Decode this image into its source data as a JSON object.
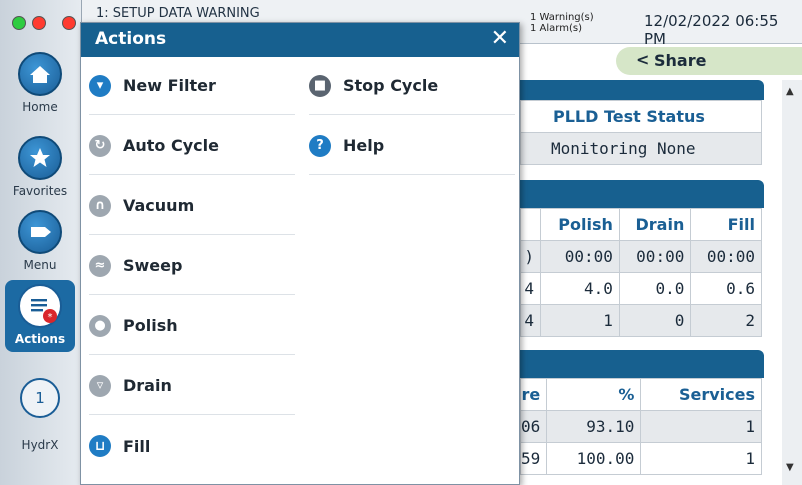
{
  "sidebar": {
    "home_label": "Home",
    "favorites_label": "Favorites",
    "menu_label": "Menu",
    "actions_label": "Actions",
    "hydrx_badge": "1",
    "hydrx_label": "HydrX"
  },
  "header": {
    "title_partial": "1: SETUP DATA WARNING",
    "warnings_line1": "1 Warning(s)",
    "warnings_line2": "1 Alarm(s)",
    "datetime": "12/02/2022 06:55 PM",
    "share_label": "Share"
  },
  "plld_table": {
    "header": "PLLD Test Status",
    "value": "Monitoring None"
  },
  "cycle_table": {
    "headers": [
      "Polish",
      "Drain",
      "Fill"
    ],
    "rows": [
      {
        "clip": ")",
        "polish": "00:00",
        "drain": "00:00",
        "fill": "00:00"
      },
      {
        "clip": "4",
        "polish": "4.0",
        "drain": "0.0",
        "fill": "0.6"
      },
      {
        "clip": "4",
        "polish": "1",
        "drain": "0",
        "fill": "2"
      }
    ]
  },
  "service_table": {
    "headers": [
      "re",
      "%",
      "Services"
    ],
    "rows": [
      {
        "clip": "06",
        "percent": "93.10",
        "services": "1"
      },
      {
        "clip": "59",
        "percent": "100.00",
        "services": "1"
      }
    ]
  },
  "actions_modal": {
    "title": "Actions",
    "close": "✕",
    "left_items": [
      {
        "label": "New Filter",
        "icon": "filter-icon"
      },
      {
        "label": "Auto Cycle",
        "icon": "cycle-icon"
      },
      {
        "label": "Vacuum",
        "icon": "vacuum-icon"
      },
      {
        "label": "Sweep",
        "icon": "sweep-icon"
      },
      {
        "label": "Polish",
        "icon": "polish-icon"
      },
      {
        "label": "Drain",
        "icon": "drain-icon"
      },
      {
        "label": "Fill",
        "icon": "fill-icon"
      }
    ],
    "right_items": [
      {
        "label": "Stop Cycle",
        "icon": "stop-icon"
      },
      {
        "label": "Help",
        "icon": "help-icon",
        "glyph": "?"
      }
    ]
  }
}
